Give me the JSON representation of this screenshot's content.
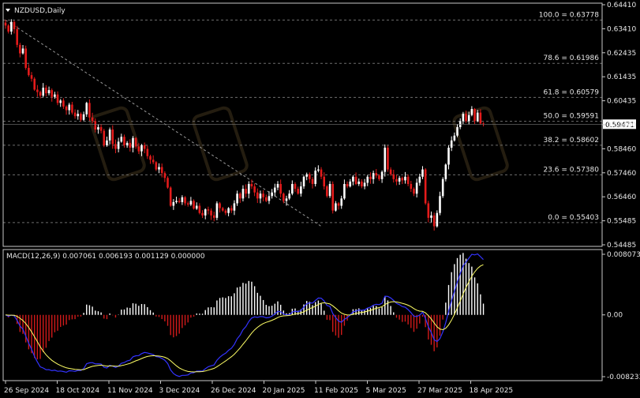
{
  "chart_title": "NZDUSD,Daily",
  "colors": {
    "background": "#000000",
    "border": "#c8c8c8",
    "grid": "#6e6e6e",
    "up_candle": "#ffffff",
    "down_candle": "#e41b1b",
    "macd_line": "#3333ff",
    "signal_line": "#ffff66",
    "hist_pos": "#ffffff",
    "hist_neg": "#d11a1a",
    "price_box": "#ffffff"
  },
  "chart_data": [
    {
      "type": "candlestick",
      "title": "NZDUSD,Daily",
      "ylim": [
        0.54485,
        0.6441
      ],
      "y_ticks": [
        "0.64410",
        "0.63410",
        "0.62435",
        "0.61435",
        "0.60435",
        "0.59460",
        "0.58460",
        "0.57460",
        "0.56460",
        "0.55485",
        "0.54485"
      ],
      "x_ticks": [
        "26 Sep 2024",
        "18 Oct 2024",
        "11 Nov 2024",
        "3 Dec 2024",
        "26 Dec 2024",
        "20 Jan 2025",
        "11 Feb 2025",
        "5 Mar 2025",
        "27 Mar 2025",
        "18 Apr 2025"
      ],
      "current_price": "0.59471",
      "fibonacci": [
        {
          "label": "100.0 = 0.63778",
          "value": 0.63778
        },
        {
          "label": "78.6 = 0.61986",
          "value": 0.61986
        },
        {
          "label": "61.8 = 0.60579",
          "value": 0.60579
        },
        {
          "label": "50.0 = 0.59591",
          "value": 0.59591
        },
        {
          "label": "38.2 = 0.58602",
          "value": 0.58602
        },
        {
          "label": "23.6 = 0.57380",
          "value": 0.5738
        },
        {
          "label": "0.0 = 0.55403",
          "value": 0.55403
        }
      ],
      "trendline": [
        {
          "bar": 0,
          "value": 0.63778
        },
        {
          "bar": 109,
          "value": 0.5525
        }
      ],
      "close": [
        0.6355,
        0.633,
        0.637,
        0.634,
        0.6275,
        0.624,
        0.626,
        0.618,
        0.615,
        0.6135,
        0.609,
        0.608,
        0.6065,
        0.6098,
        0.6075,
        0.6088,
        0.606,
        0.607,
        0.6035,
        0.6045,
        0.602,
        0.6005,
        0.6028,
        0.5995,
        0.598,
        0.599,
        0.5965,
        0.5988,
        0.6035,
        0.5975,
        0.596,
        0.5925,
        0.5935,
        0.592,
        0.586,
        0.588,
        0.5925,
        0.5865,
        0.5845,
        0.5875,
        0.5895,
        0.586,
        0.587,
        0.585,
        0.589,
        0.5855,
        0.5835,
        0.586,
        0.5845,
        0.5815,
        0.58,
        0.579,
        0.576,
        0.577,
        0.5745,
        0.5725,
        0.5685,
        0.561,
        0.5625,
        0.563,
        0.5625,
        0.5645,
        0.562,
        0.5615,
        0.563,
        0.5598,
        0.561,
        0.558,
        0.557,
        0.5595,
        0.559,
        0.557,
        0.556,
        0.562,
        0.56,
        0.559,
        0.558,
        0.56,
        0.559,
        0.562,
        0.566,
        0.564,
        0.568,
        0.566,
        0.57,
        0.569,
        0.5665,
        0.564,
        0.566,
        0.5645,
        0.563,
        0.565,
        0.5665,
        0.5685,
        0.57,
        0.566,
        0.563,
        0.564,
        0.566,
        0.57,
        0.568,
        0.566,
        0.569,
        0.573,
        0.574,
        0.572,
        0.57,
        0.5755,
        0.576,
        0.573,
        0.569,
        0.565,
        0.57,
        0.559,
        0.562,
        0.561,
        0.564,
        0.57,
        0.569,
        0.571,
        0.573,
        0.57,
        0.571,
        0.569,
        0.5705,
        0.573,
        0.572,
        0.5745,
        0.5735,
        0.572,
        0.575,
        0.585,
        0.576,
        0.574,
        0.572,
        0.571,
        0.5725,
        0.5715,
        0.573,
        0.57,
        0.568,
        0.566,
        0.5705,
        0.573,
        0.576,
        0.562,
        0.556,
        0.557,
        0.5525,
        0.558,
        0.565,
        0.572,
        0.578,
        0.585,
        0.588,
        0.59,
        0.5935,
        0.596,
        0.599,
        0.596,
        0.5985,
        0.601,
        0.596,
        0.5995,
        0.595,
        0.5947
      ]
    },
    {
      "type": "macd",
      "title": "MACD(12,26,9) 0.007061 0.006193 0.001129 0.000000",
      "ylim": [
        -0.008233,
        0.008073
      ],
      "y_ticks": [
        "0.008073",
        "0.00",
        "-0.008233"
      ]
    }
  ]
}
